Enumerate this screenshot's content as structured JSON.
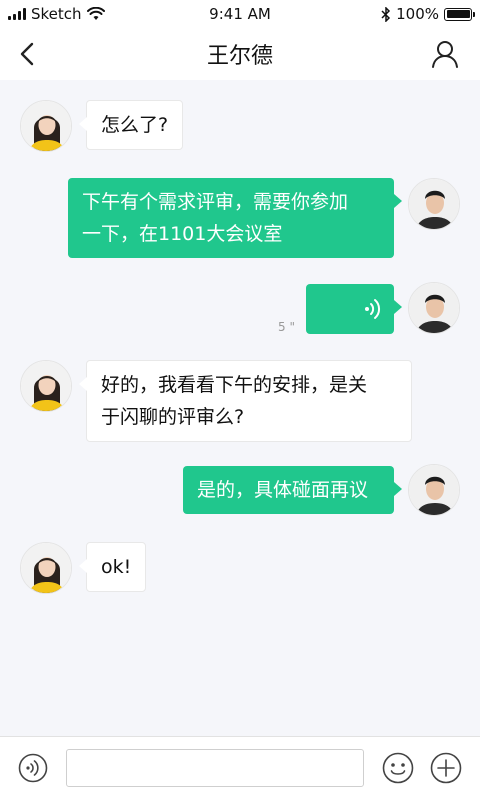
{
  "status_bar": {
    "carrier": "Sketch",
    "time": "9:41 AM",
    "battery": "100%",
    "icons": [
      "signal-icon",
      "wifi-icon",
      "bluetooth-icon",
      "battery-icon"
    ]
  },
  "nav": {
    "title": "王尔德",
    "back_icon": "chevron-left-icon",
    "profile_icon": "user-icon"
  },
  "messages": [
    {
      "side": "left",
      "type": "text",
      "text": "怎么了?"
    },
    {
      "side": "right",
      "type": "text",
      "lines": [
        "下午有个需求评审，需要你参加",
        "一下，在1101大会议室"
      ]
    },
    {
      "side": "right",
      "type": "voice",
      "duration": "5 \""
    },
    {
      "side": "left",
      "type": "text",
      "lines": [
        "好的，我看看下午的安排，是关",
        "于闪聊的评审么?"
      ]
    },
    {
      "side": "right",
      "type": "text",
      "text": "是的，具体碰面再议"
    },
    {
      "side": "left",
      "type": "text",
      "text": "ok!"
    }
  ],
  "input_bar": {
    "placeholder": "",
    "icons": [
      "voice-icon",
      "emoji-icon",
      "plus-icon"
    ]
  },
  "colors": {
    "accent": "#20c78d",
    "background": "#f5f6fa",
    "bubble_left": "#ffffff"
  }
}
